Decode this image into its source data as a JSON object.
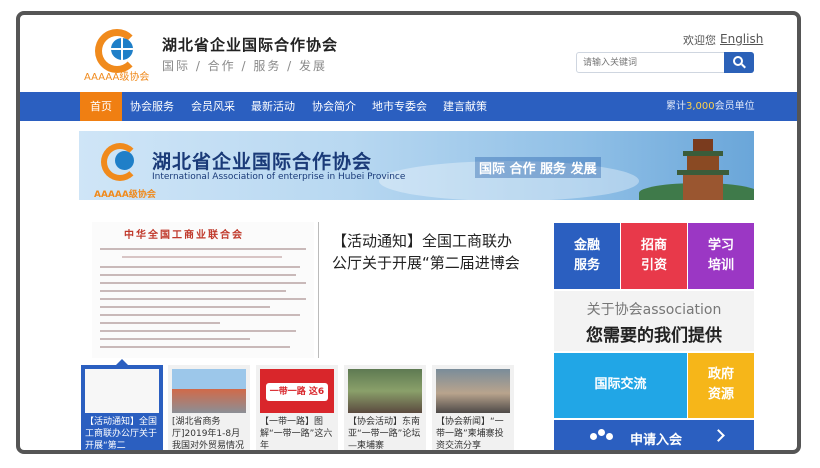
{
  "header": {
    "logo_sub": "AAAAA级协会",
    "title": "湖北省企业国际合作协会",
    "tagline": "国际 / 合作 / 服务 / 发展",
    "welcome": "欢迎您",
    "english": "English",
    "search_placeholder": "请输入关键词"
  },
  "nav": {
    "items": [
      "首页",
      "协会服务",
      "会员风采",
      "最新活动",
      "协会简介",
      "地市专委会",
      "建言献策"
    ],
    "count_prefix": "累计",
    "count_value": "3,000",
    "count_suffix": "会员单位"
  },
  "banner": {
    "title": "湖北省企业国际合作协会",
    "english": "International Association of enterprise in Hubei Province",
    "sub": "AAAAA级协会",
    "slogan": "国际 合作 服务 发展"
  },
  "featured": {
    "doc_header": "中华全国工商业联合会",
    "headline": "【活动通知】全国工商联办公厅关于开展“第二届进博会"
  },
  "thumbnails": [
    {
      "caption": "【活动通知】全国工商联办公厅关于开展“第二"
    },
    {
      "caption": "[湖北省商务厅]2019年1-8月我国对外贸易情况"
    },
    {
      "caption": "【一带一路】图解“一带一路”这六年"
    },
    {
      "caption": "【协会活动】东南亚“一带一路”论坛—柬埔寨"
    },
    {
      "caption": "【协会新闻】“一带一路”柬埔寨投资交流分享"
    }
  ],
  "thumb_overlay": "一带一路 这6年!",
  "tiles": {
    "finance_1": "金融",
    "finance_2": "服务",
    "invest_1": "招商",
    "invest_2": "引资",
    "learn_1": "学习",
    "learn_2": "培训",
    "assoc_line1": "关于协会association",
    "assoc_line2": "您需要的我们提供",
    "intl": "国际交流",
    "gov_1": "政府",
    "gov_2": "资源",
    "apply": "申请入会"
  },
  "colors": {
    "nav_blue": "#2b5fc0",
    "accent_orange": "#f07f12",
    "tile_red": "#e8394a",
    "tile_purple": "#9b37c4",
    "tile_cyan": "#21a6e6",
    "tile_yellow": "#f6b619"
  }
}
